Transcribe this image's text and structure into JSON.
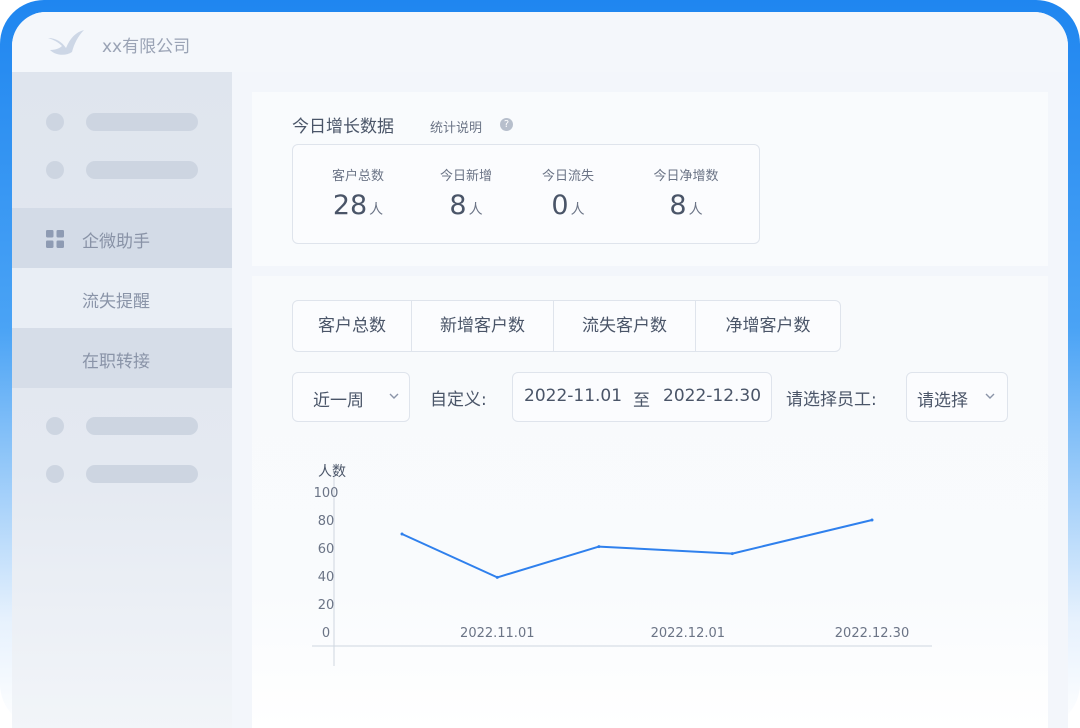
{
  "app": {
    "company_name": "xx有限公司"
  },
  "sidebar": {
    "group_label": "企微助手",
    "items": [
      {
        "label": "流失提醒",
        "active": true
      },
      {
        "label": "在职转接",
        "active": false
      }
    ]
  },
  "today_stats": {
    "title": "今日增长数据",
    "note": "统计说明",
    "cards": [
      {
        "label": "客户总数",
        "value": "28",
        "unit": "人"
      },
      {
        "label": "今日新增",
        "value": "8",
        "unit": "人"
      },
      {
        "label": "今日流失",
        "value": "0",
        "unit": "人"
      },
      {
        "label": "今日净增数",
        "value": "8",
        "unit": "人"
      }
    ]
  },
  "tabs": [
    "客户总数",
    "新增客户数",
    "流失客户数",
    "净增客户数"
  ],
  "filters": {
    "period": "近一周",
    "custom_label": "自定义:",
    "date_start": "2022-11.01",
    "date_sep": "至",
    "date_end": "2022-12.30",
    "employee_label": "请选择员工:",
    "employee_value": "请选择"
  },
  "chart_data": {
    "type": "line",
    "ylabel": "人数",
    "ylim": [
      0,
      100
    ],
    "yticks": [
      0,
      20,
      40,
      60,
      80,
      100
    ],
    "x_tick_labels": [
      "2022.11.01",
      "2022.12.01",
      "2022.12.30"
    ],
    "points": [
      {
        "x": "2022.10.17",
        "y": 70
      },
      {
        "x": "2022.11.01",
        "y": 39
      },
      {
        "x": "2022.11.17",
        "y": 61
      },
      {
        "x": "2022.12.08",
        "y": 56
      },
      {
        "x": "2022.12.30",
        "y": 80
      }
    ],
    "grid": false,
    "colors": {
      "line": "#2f80ed",
      "axis": "#cfd6e0"
    }
  }
}
